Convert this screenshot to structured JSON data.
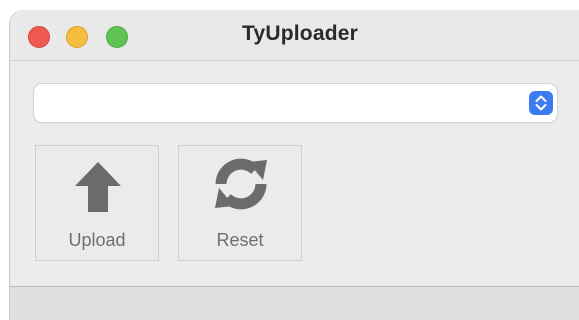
{
  "window": {
    "title": "TyUploader"
  },
  "board_select": {
    "value": ""
  },
  "toolbar": {
    "upload_label": "Upload",
    "reset_label": "Reset"
  },
  "icons": {
    "upload": "arrow-up-icon",
    "reset": "refresh-icon",
    "select": "chevron-up-down-icon"
  },
  "colors": {
    "close": "#ee5a52",
    "minimize": "#f5bd3e",
    "maximize": "#5fc454",
    "accent": "#3b7cf0",
    "icon_gray": "#6b6b6b"
  }
}
